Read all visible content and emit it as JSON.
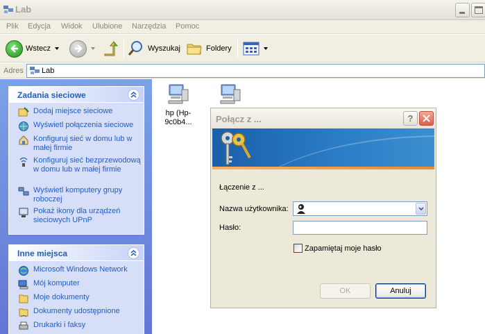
{
  "window": {
    "title": "Lab"
  },
  "menu": {
    "items": [
      "Plik",
      "Edycja",
      "Widok",
      "Ulubione",
      "Narzędzia",
      "Pomoc"
    ]
  },
  "toolbar": {
    "back": "Wstecz",
    "search": "Wyszukaj",
    "folders": "Foldery"
  },
  "address": {
    "label": "Adres",
    "value": "Lab"
  },
  "tasks_panel": {
    "title": "Zadania sieciowe",
    "items": [
      {
        "label": "Dodaj miejsce sieciowe",
        "icon": "add-network-place-icon"
      },
      {
        "label": "Wyświetl połączenia sieciowe",
        "icon": "network-connections-icon"
      },
      {
        "label": "Konfiguruj sieć w domu lub w małej firmie",
        "icon": "home-network-icon"
      },
      {
        "label": "Konfiguruj sieć bezprzewodową w domu lub w małej firmie",
        "icon": "wireless-network-icon"
      },
      {
        "label": "Wyświetl komputery grupy roboczej",
        "icon": "workgroup-computers-icon"
      },
      {
        "label": "Pokaż ikony dla urządzeń sieciowych UPnP",
        "icon": "upnp-icon"
      }
    ]
  },
  "places_panel": {
    "title": "Inne miejsca",
    "items": [
      {
        "label": "Microsoft Windows Network",
        "icon": "windows-network-icon"
      },
      {
        "label": "Mój komputer",
        "icon": "my-computer-icon"
      },
      {
        "label": "Moje dokumenty",
        "icon": "my-documents-icon"
      },
      {
        "label": "Dokumenty udostępnione",
        "icon": "shared-documents-icon"
      },
      {
        "label": "Drukarki i faksy",
        "icon": "printers-icon"
      }
    ]
  },
  "computers": [
    {
      "label": "hp (Hp-9c0b4..."
    },
    {
      "label": ""
    }
  ],
  "dialog": {
    "title": "Połącz z ...",
    "connecting": "Łączenie z ...",
    "username_label": "Nazwa użytkownika:",
    "password_label": "Hasło:",
    "remember_label": "Zapamiętaj moje hasło",
    "ok": "OK",
    "cancel": "Anuluj",
    "remember_checked": false
  },
  "colors": {
    "accent": "#215dc6",
    "pane_bg": "#6375d6",
    "panel_bg": "#d6dff7",
    "banner": "#1a5fa8"
  }
}
